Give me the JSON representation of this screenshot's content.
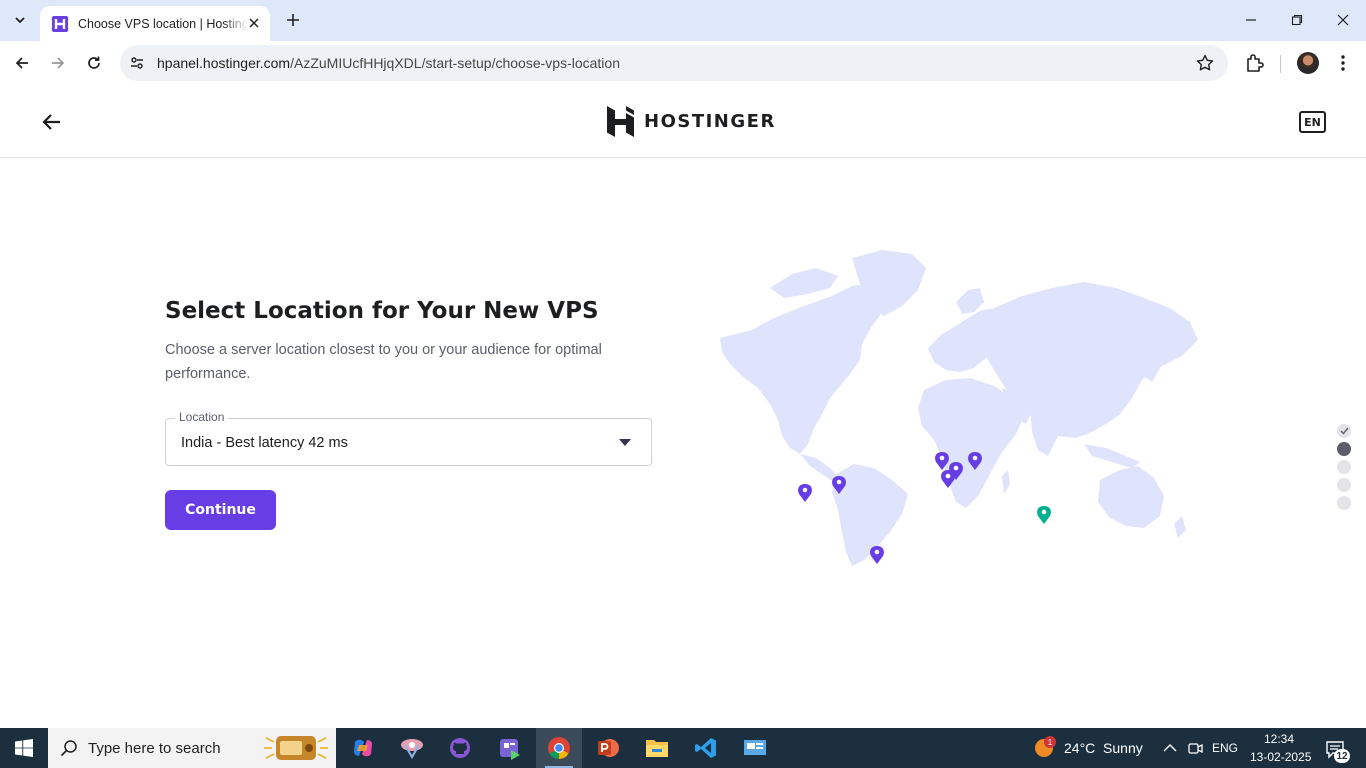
{
  "browser": {
    "tab_title": "Choose VPS location | Hostinger",
    "url_host": "hpanel.hostinger.com",
    "url_path": "/AzZuMIUcfHHjqXDL/start-setup/choose-vps-location"
  },
  "header": {
    "brand": "HOSTINGER",
    "language": "EN"
  },
  "main": {
    "title": "Select Location for Your New VPS",
    "subtitle": "Choose a server location closest to you or your audience for optimal performance.",
    "location_label": "Location",
    "location_value": "India - Best latency 42 ms",
    "continue_label": "Continue"
  },
  "map": {
    "pin_color": "#673de6",
    "selected_pin_color": "#00b090",
    "land_color": "#dfe3fb"
  },
  "steps": {
    "total": 5,
    "completed": 1,
    "current": 2
  },
  "taskbar": {
    "search_placeholder": "Type here to search",
    "weather": "24°C  Sunny",
    "language": "ENG",
    "time": "12:34",
    "date": "13-02-2025",
    "notifications": "12",
    "weather_badge": "1"
  },
  "colors": {
    "accent": "#673de6",
    "taskbar": "#1c2f3f",
    "tabbar": "#dfe8f8"
  }
}
